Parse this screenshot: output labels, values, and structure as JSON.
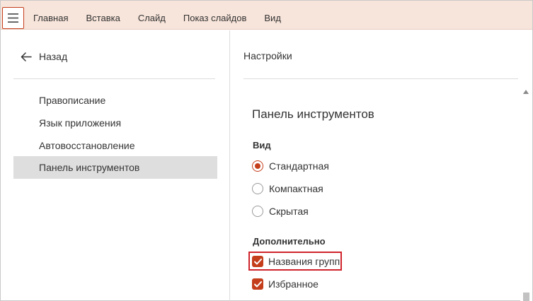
{
  "topbar": {
    "menu_icon": "hamburger-icon",
    "tabs": [
      {
        "label": "Главная"
      },
      {
        "label": "Вставка"
      },
      {
        "label": "Слайд"
      },
      {
        "label": "Показ слайдов"
      },
      {
        "label": "Вид"
      }
    ]
  },
  "left": {
    "back_label": "Назад",
    "back_icon": "arrow-left-icon",
    "items": [
      {
        "label": "Правописание"
      },
      {
        "label": "Язык приложения"
      },
      {
        "label": "Автовосстановление"
      },
      {
        "label": "Панель инструментов",
        "selected": true
      }
    ]
  },
  "right": {
    "title": "Настройки",
    "section_title": "Панель инструментов",
    "view_label": "Вид",
    "view_options": [
      {
        "label": "Стандартная",
        "checked": true
      },
      {
        "label": "Компактная",
        "checked": false
      },
      {
        "label": "Скрытая",
        "checked": false
      }
    ],
    "extra_label": "Дополнительно",
    "extra_options": [
      {
        "label": "Названия групп",
        "checked": true
      },
      {
        "label": "Избранное",
        "checked": true
      }
    ]
  },
  "colors": {
    "accent": "#c43e1c",
    "topbar_bg": "#f7e4da",
    "selected_bg": "#dedede",
    "highlight": "#d0232b"
  }
}
